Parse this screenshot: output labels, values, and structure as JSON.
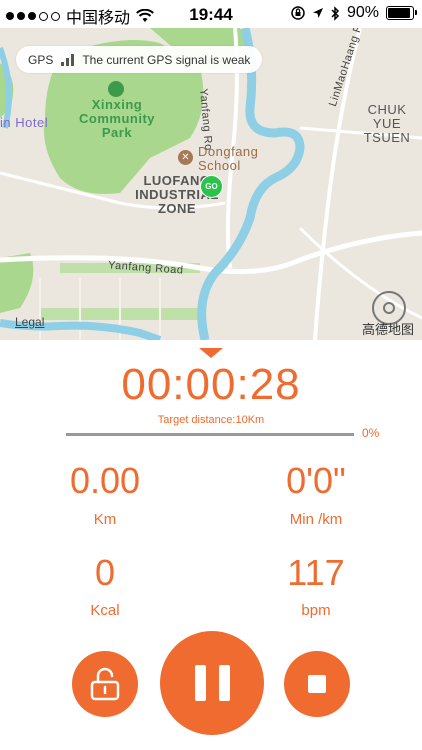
{
  "status_bar": {
    "carrier": "中国移动",
    "time": "19:44",
    "battery": "90%"
  },
  "map": {
    "gps_label": "GPS",
    "gps_message": "The current GPS signal is weak",
    "labels": {
      "hotel": "in Hotel",
      "park": "Xinxing\nCommunity\nPark",
      "school": "Dongfang\nSchool",
      "zone": "LUOFANG\nINDUSTRIAL\nZONE",
      "road_yanfang": "Yanfang Road",
      "road_yanfang_vert": "Yanfang Ro",
      "road_linmaohaang": "LinMaoHaang Rd",
      "chuk_yuen": "CHUK YUE\nTSUEN",
      "legal": "Legal",
      "provider": "高德地图",
      "go_marker": "GO"
    }
  },
  "workout": {
    "timer": "00:00:28",
    "target": "Target distance:10Km",
    "progress_percent": "0%",
    "progress_fraction": 0,
    "distance_value": "0.00",
    "distance_unit": "Km",
    "pace_value": "0'0\"",
    "pace_unit": "Min /km",
    "calories_value": "0",
    "calories_unit": "Kcal",
    "heart_value": "117",
    "heart_unit": "bpm"
  },
  "controls": {
    "lock": "lock-icon",
    "pause": "pause-icon",
    "stop": "stop-icon"
  },
  "colors": {
    "accent": "#ef6b2f",
    "go_marker": "#27c54a",
    "park_green": "#a9d78d",
    "river": "#8ecfe6"
  }
}
